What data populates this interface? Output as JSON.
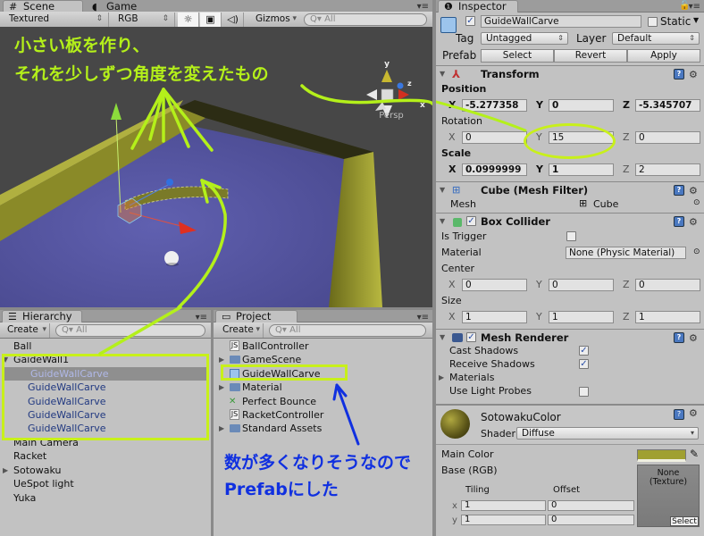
{
  "scene_tabs": {
    "scene_label": "Scene",
    "game_label": "Game"
  },
  "scene_toolbar": {
    "draw_mode": "Textured",
    "render_mode": "RGB",
    "gizmos_label": "Gizmos",
    "search_placeholder": "All"
  },
  "scene_view": {
    "projection_label": "Persp",
    "gizmo_axes": {
      "y": "y",
      "z": "z",
      "x": "x"
    },
    "annotation_top_line1": "小さい板を作り、",
    "annotation_top_line2": "それを少しずつ角度を変えたもの",
    "colors": {
      "floor": "#5a5aa8",
      "wall": "#a8a830",
      "annotation_green": "#b4f01a",
      "annotation_blue": "#1030e0"
    }
  },
  "hierarchy": {
    "tab_label": "Hierarchy",
    "create_label": "Create",
    "search_placeholder": "All",
    "items": [
      {
        "label": "Ball",
        "indent": 0,
        "expander": "none"
      },
      {
        "label": "GaideWall1",
        "indent": 0,
        "expander": "expanded"
      },
      {
        "label": "GuideWallCarve",
        "indent": 1,
        "expander": "none",
        "selected": true,
        "prefab": true
      },
      {
        "label": "GuideWallCarve",
        "indent": 1,
        "expander": "none",
        "prefab": true
      },
      {
        "label": "GuideWallCarve",
        "indent": 1,
        "expander": "none",
        "prefab": true
      },
      {
        "label": "GuideWallCarve",
        "indent": 1,
        "expander": "none",
        "prefab": true
      },
      {
        "label": "GuideWallCarve",
        "indent": 1,
        "expander": "none",
        "prefab": true
      },
      {
        "label": "Main Camera",
        "indent": 0,
        "expander": "none"
      },
      {
        "label": "Racket",
        "indent": 0,
        "expander": "none"
      },
      {
        "label": "Sotowaku",
        "indent": 0,
        "expander": "collapsed"
      },
      {
        "label": "UeSpot light",
        "indent": 0,
        "expander": "none"
      },
      {
        "label": "Yuka",
        "indent": 0,
        "expander": "none"
      }
    ]
  },
  "project": {
    "tab_label": "Project",
    "create_label": "Create",
    "search_placeholder": "All",
    "items": [
      {
        "label": "BallController",
        "icon": "script-icon",
        "expander": "none"
      },
      {
        "label": "GameScene",
        "icon": "folder-icon",
        "expander": "collapsed"
      },
      {
        "label": "GuideWallCarve",
        "icon": "prefab-icon",
        "expander": "none"
      },
      {
        "label": "Material",
        "icon": "folder-icon",
        "expander": "collapsed"
      },
      {
        "label": "Perfect Bounce",
        "icon": "physic-material-icon",
        "expander": "none"
      },
      {
        "label": "RacketController",
        "icon": "script-icon",
        "expander": "none"
      },
      {
        "label": "Standard Assets",
        "icon": "folder-icon",
        "expander": "collapsed"
      }
    ],
    "annotation_line1": "数が多くなりそうなので",
    "annotation_line2": "Prefabにした"
  },
  "inspector": {
    "tab_label": "Inspector",
    "object_name": "GuideWallCarve",
    "active": true,
    "static_label": "Static",
    "static_checked": false,
    "tag_label": "Tag",
    "tag_value": "Untagged",
    "layer_label": "Layer",
    "layer_value": "Default",
    "prefab_label": "Prefab",
    "prefab_buttons": [
      "Select",
      "Revert",
      "Apply"
    ],
    "transform": {
      "title": "Transform",
      "position_label": "Position",
      "position": {
        "x": "-5.277358",
        "y": "0",
        "z": "-5.345707"
      },
      "rotation_label": "Rotation",
      "rotation": {
        "x": "0",
        "y": "15",
        "z": "0"
      },
      "scale_label": "Scale",
      "scale": {
        "x": "0.0999999",
        "y": "1",
        "z": "2"
      }
    },
    "mesh_filter": {
      "title": "Cube (Mesh Filter)",
      "mesh_label": "Mesh",
      "mesh_value": "Cube"
    },
    "box_collider": {
      "title": "Box Collider",
      "enabled": true,
      "is_trigger_label": "Is Trigger",
      "is_trigger": false,
      "material_label": "Material",
      "material_value": "None (Physic Material)",
      "center_label": "Center",
      "center": {
        "x": "0",
        "y": "0",
        "z": "0"
      },
      "size_label": "Size",
      "size": {
        "x": "1",
        "y": "1",
        "z": "1"
      }
    },
    "mesh_renderer": {
      "title": "Mesh Renderer",
      "enabled": true,
      "cast_shadows_label": "Cast Shadows",
      "cast_shadows": true,
      "receive_shadows_label": "Receive Shadows",
      "receive_shadows": true,
      "materials_label": "Materials",
      "use_light_probes_label": "Use Light Probes",
      "use_light_probes": false
    },
    "material": {
      "name": "SotowakuColor",
      "shader_label": "Shader",
      "shader_value": "Diffuse",
      "main_color_label": "Main Color",
      "main_color": "#a0a030",
      "base_label": "Base (RGB)",
      "tiling_label": "Tiling",
      "offset_label": "Offset",
      "tiling": {
        "x": "1",
        "y": "1"
      },
      "offset": {
        "x": "0",
        "y": "0"
      },
      "texture_none_line1": "None",
      "texture_none_line2": "(Texture)",
      "texture_select_label": "Select"
    },
    "axis": {
      "x": "X",
      "y": "Y",
      "z": "Z",
      "lx": "x",
      "ly": "y"
    }
  }
}
